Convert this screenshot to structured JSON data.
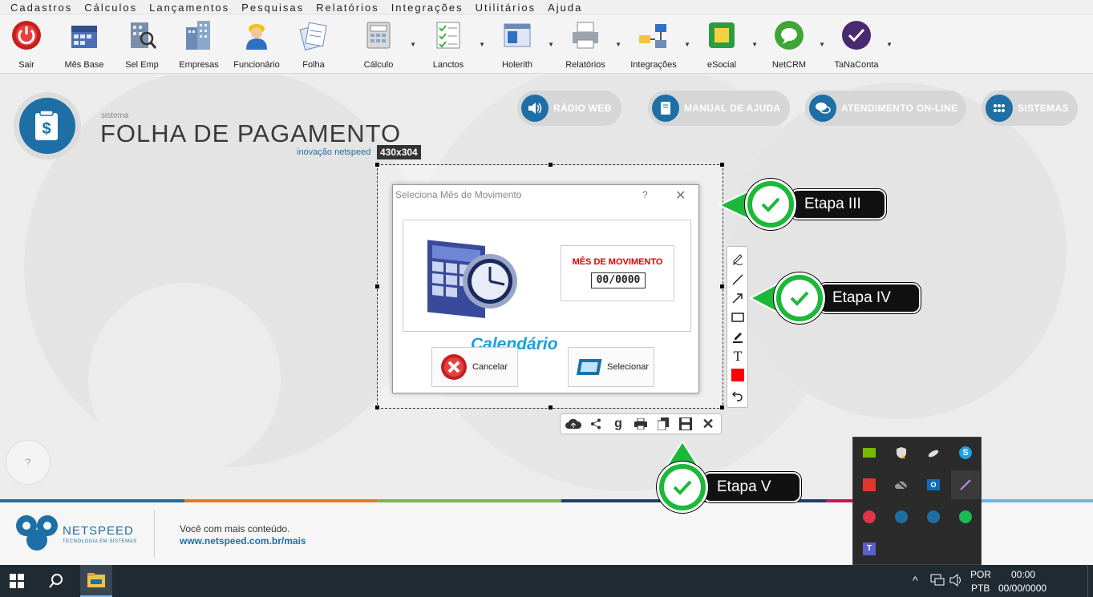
{
  "menu": [
    "Cadastros",
    "Cálculos",
    "Lançamentos",
    "Pesquisas",
    "Relatórios",
    "Integrações",
    "Utilitários",
    "Ajuda"
  ],
  "toolbar": [
    {
      "label": "Sair",
      "icon": "power-icon",
      "dropdown": false
    },
    {
      "label": "Mês Base",
      "icon": "calendar-icon",
      "dropdown": false
    },
    {
      "label": "Sel Emp",
      "icon": "building-search-icon",
      "dropdown": false
    },
    {
      "label": "Empresas",
      "icon": "buildings-icon",
      "dropdown": false
    },
    {
      "label": "Funcionário",
      "icon": "worker-icon",
      "dropdown": false
    },
    {
      "label": "Folha",
      "icon": "papers-icon",
      "dropdown": false
    },
    {
      "label": "Cálculo",
      "icon": "calculator-icon",
      "dropdown": true
    },
    {
      "label": "Lanctos",
      "icon": "checklist-icon",
      "dropdown": true
    },
    {
      "label": "Holerith",
      "icon": "window-icon",
      "dropdown": true
    },
    {
      "label": "Relatórios",
      "icon": "printer-icon",
      "dropdown": true
    },
    {
      "label": "Integrações",
      "icon": "network-icon",
      "dropdown": true
    },
    {
      "label": "eSocial",
      "icon": "esocial-icon",
      "dropdown": true
    },
    {
      "label": "NetCRM",
      "icon": "chat-bubble-icon",
      "dropdown": true
    },
    {
      "label": "TaNaConta",
      "icon": "tanaconta-icon",
      "dropdown": true
    }
  ],
  "header": {
    "system_small": "sistema",
    "system_title": "FOLHA DE PAGAMENTO",
    "system_sub": "inovação netspeed",
    "pills": [
      {
        "label": "RÁDIO WEB",
        "icon": "speaker-icon"
      },
      {
        "label": "MANUAL DE AJUDA",
        "icon": "book-icon"
      },
      {
        "label": "ATENDIMENTO ON-LINE",
        "icon": "chat-icon"
      },
      {
        "label": "SISTEMAS",
        "icon": "grid-icon"
      }
    ]
  },
  "help_label": "?",
  "footer": {
    "brand": "NETSPEED",
    "tagline": "TECNOLOGIA EM SISTEMAS",
    "line1": "Você com mais conteúdo.",
    "line2": "www.netspeed.com.br/mais"
  },
  "capture": {
    "size": "430x304"
  },
  "dialog": {
    "title": "Seleciona Mês de Movimento",
    "help": "?",
    "close": "✕",
    "calendar_text": "Calendário",
    "month_label": "MÊS DE MOVIMENTO",
    "month_value": "00/0000",
    "cancel_label": "Cancelar",
    "select_label": "Selecionar"
  },
  "steps": [
    "Etapa III",
    "Etapa IV",
    "Etapa V"
  ],
  "taskbar": {
    "lang1": "POR",
    "lang2": "PTB",
    "time": "00:00",
    "date": "00/00/0000"
  },
  "colors": {
    "brand_blue": "#1d6fa5",
    "step_green": "#1db839",
    "alert_red": "#e00000"
  }
}
